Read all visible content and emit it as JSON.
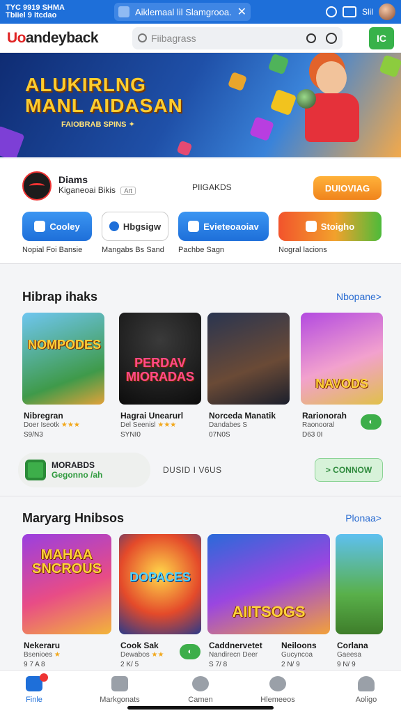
{
  "status_bar": {
    "left_line1": "TYC 9919 SHMA",
    "left_line2": "Tbiiel 9 Itcdao",
    "notification": "Aiklemaal lil Slamgrooa.",
    "signal_text": "Slil"
  },
  "header": {
    "logo_red": "Uo",
    "logo_dark": "andeyback",
    "search_placeholder": "Fiibagrass",
    "action_label": "IC"
  },
  "banner": {
    "line1": "ALUKIRLNG",
    "line2": "MANL AIDASAN",
    "tagline": "FAIOBRAB SPINS"
  },
  "account": {
    "name": "Diams",
    "subtitle": "Kiganeoai Bikis",
    "tag": "Art",
    "middle_text": "PIIGAKDS",
    "button": "DUIOVIAG"
  },
  "quick_actions": [
    {
      "label": "Cooley",
      "caption": "Nopial Foi Bansie"
    },
    {
      "label": "Hbgsigw",
      "caption": "Mangabs Bs Sand"
    },
    {
      "label": "Evieteoaoiav",
      "caption": "Pachbe Sagn"
    },
    {
      "label": "Stoigho",
      "caption": "Nogral lacions"
    }
  ],
  "section1": {
    "title": "Hibrap ihaks",
    "more": "Nbopane>",
    "games": [
      {
        "tile_text": "NOMPODES",
        "name": "Nibregran",
        "meta": "Doer Iseotk",
        "price": "S9/N3"
      },
      {
        "tile_text": "PERDAV MIORADAS",
        "name": "Hagrai Unearurl",
        "meta": "Del Seenisl",
        "price": "SYNI0"
      },
      {
        "tile_text": "",
        "name": "Norceda Manatik",
        "meta": "Dandabes S",
        "price": "07N0S"
      },
      {
        "tile_text": "NAVODS",
        "name": "Rarionorah",
        "meta": "Raonooral",
        "price": "D63 0I"
      }
    ]
  },
  "promo": {
    "title": "MORABDS",
    "subtitle": "Gegonno",
    "accent": "/ah",
    "middle_text": "DUSID I V6US",
    "button": "CONNOW"
  },
  "section2": {
    "title": "Maryarg Hnibsos",
    "more": "Plonaa>",
    "games": [
      {
        "tile_text": "MAHAA SNCROUS",
        "name": "Nekeraru",
        "meta": "Bsenioes",
        "price": "9 7 A 8"
      },
      {
        "tile_text": "DOPACES",
        "name": "Cook Sak",
        "meta": "Dewabos",
        "price": "2 K/ 5"
      },
      {
        "tile_text": "AIITSOGS",
        "name": "Caddnervetet",
        "meta": "Nandirecn Deer",
        "price": "S 7/ 8"
      },
      {
        "tile_text": "",
        "name": "Neiloons",
        "meta": "Gucyncoa",
        "price": "2 N/ 9"
      },
      {
        "tile_text": "",
        "name": "Corlana",
        "meta": "Gaeesa",
        "price": "9 N/ 9"
      }
    ]
  },
  "nav": [
    {
      "label": "Finle"
    },
    {
      "label": "Markgonats"
    },
    {
      "label": "Camen"
    },
    {
      "label": "Hlemeeos"
    },
    {
      "label": "Aoligo"
    }
  ]
}
